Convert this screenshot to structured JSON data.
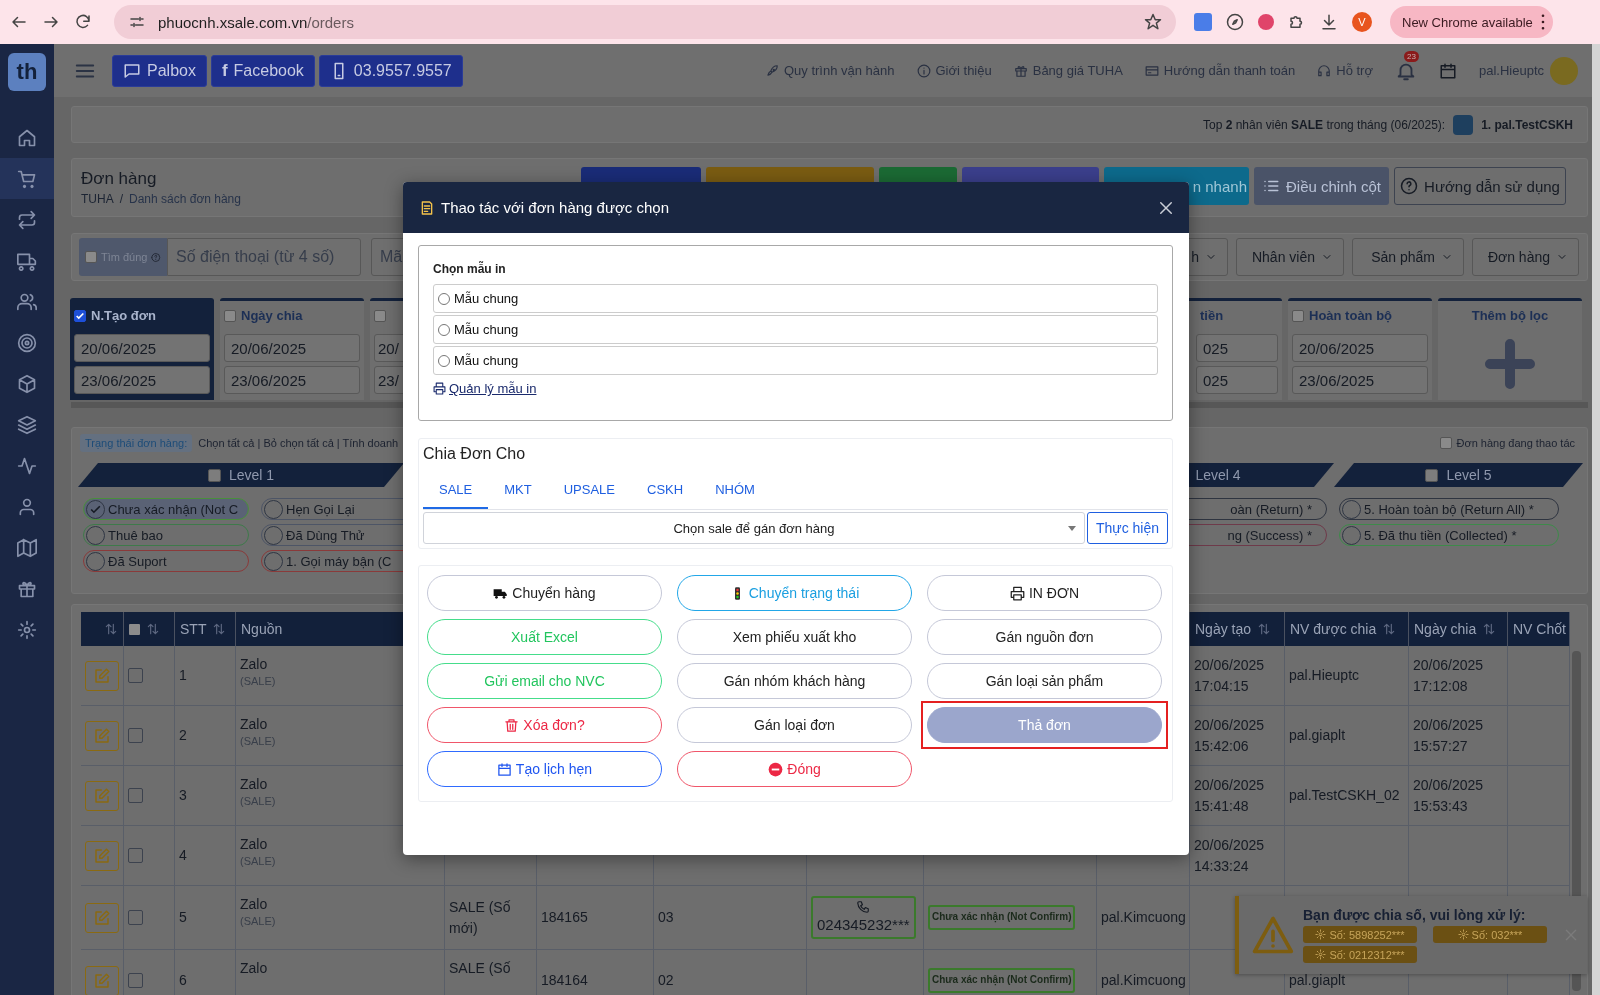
{
  "browser": {
    "host": "phuocnh.xsale.com.vn",
    "path": "/orders",
    "profile_initial": "V",
    "update_label": "New Chrome available"
  },
  "sidebar": {
    "logo": "th",
    "items": [
      {
        "selected": false
      },
      {
        "selected": true
      },
      {
        "selected": false
      },
      {
        "selected": false
      },
      {
        "selected": false
      },
      {
        "selected": false
      },
      {
        "selected": false
      },
      {
        "selected": false
      },
      {
        "selected": false
      },
      {
        "selected": false
      },
      {
        "selected": false
      },
      {
        "selected": false
      },
      {
        "selected": false
      }
    ]
  },
  "header": {
    "buttons": [
      {
        "label": "Palbox"
      },
      {
        "label": "Facebook",
        "icon_text": "f"
      },
      {
        "label": "03.9557.9557"
      }
    ],
    "links": [
      "Quy trình vận hành",
      "Giới thiệu",
      "Bảng giá TUHA",
      "Hướng dẫn thanh toán",
      "Hỗ trợ"
    ],
    "notification_count": "23",
    "user": "pal.Hieuptc"
  },
  "ranking": {
    "text": "Top **2** nhân viên **SALE** trong tháng (06/2025):",
    "leader": "1. pal.TestCSKH"
  },
  "page": {
    "title": "Đơn hàng",
    "breadcrumb": [
      "TUHA",
      "Danh sách đơn hàng"
    ],
    "breadcrumb_separator": "/"
  },
  "toolbar": [
    {
      "kind": "solid",
      "color": "#1a2c78"
    },
    {
      "kind": "solid",
      "color": "#7a5c12"
    },
    {
      "kind": "solid",
      "color": "#1b6a34"
    },
    {
      "kind": "solid",
      "color": "#3b3f8c"
    },
    {
      "kind": "solid",
      "color": "#0d6a8c",
      "label": "n nhanh"
    },
    {
      "kind": "list",
      "color": "#4a5368",
      "label": "Điều chỉnh cột"
    },
    {
      "kind": "help",
      "color": "#6e6e6e",
      "label": "Hướng dẫn sử dụng"
    }
  ],
  "search": {
    "exact_match": {
      "label": "Tìm đúng",
      "checked": false
    },
    "phone_placeholder": "Số điện thoại (từ 4 số)",
    "code_placeholder": "Mã",
    "dropdowns": [
      "h",
      "Nhân viên",
      "Sản phẩm",
      "Đơn hàng"
    ]
  },
  "date_filters": {
    "left": [
      {
        "label": "N.Tạo đơn",
        "checked": true,
        "from": "20/06/2025",
        "to": "23/06/2025"
      },
      {
        "label": "Ngày chia",
        "checked": false,
        "from": "20/06/2025",
        "to": "23/06/2025"
      },
      {
        "checked": false,
        "from": "20/",
        "to": "23/"
      }
    ],
    "right": [
      {
        "label": "tiền",
        "from": "025",
        "to": "025"
      },
      {
        "label": "Hoàn toàn bộ",
        "checked": false,
        "from": "20/06/2025",
        "to": "23/06/2025"
      }
    ],
    "add_label": "Thêm bộ lọc"
  },
  "status_filter": {
    "tag": "Trạng thái đơn hàng:",
    "actions": "Chọn tất cả | Bỏ chọn tất cả | Tính doanh",
    "in_progress": {
      "label": "Đơn hàng đang thao tác",
      "checked": false
    },
    "levels": [
      {
        "label": "Level 1",
        "checked": false,
        "statuses": [
          {
            "label": "Chưa xác nhận (Not C",
            "checked": true,
            "color": "#4a8f3c"
          },
          {
            "label": "Hẹn Gọi Lại",
            "checked": false,
            "color": "#4d5566"
          },
          {
            "label": "Thuê bao",
            "checked": false,
            "color": "#3e7a4a"
          },
          {
            "label": "Đã Dùng Thử",
            "checked": false,
            "color": "#4d5566"
          },
          {
            "label": "Đã Suport",
            "checked": false,
            "color": "#8a3a3a"
          },
          {
            "label": "1. Gọi máy bận (C",
            "checked": false,
            "color": "#8a3a3a"
          }
        ]
      },
      {
        "label": "Level 4",
        "statuses": [
          {
            "label": "oàn (Return) *",
            "checked": false,
            "color": "#2e3440"
          },
          {
            "label": "ng (Success) *",
            "checked": false,
            "color": "#6e3a4a"
          }
        ]
      },
      {
        "label": "Level 5",
        "checked": false,
        "statuses": [
          {
            "label": "5. Hoàn toàn bộ (Return All) *",
            "checked": false,
            "color": "#2e3440"
          },
          {
            "label": "5. Đã thu tiền (Collected) *",
            "checked": false,
            "color": "#3e8a4a"
          }
        ]
      }
    ]
  },
  "table": {
    "all_selected": false,
    "columns": [
      {
        "kind": "sort"
      },
      {
        "kind": "select"
      },
      {
        "kind": "text",
        "label": "STT",
        "sortable": true
      },
      {
        "kind": "text",
        "label": "Nguồn",
        "sortable": false
      },
      {
        "kind": "blank"
      },
      {
        "kind": "blank"
      },
      {
        "kind": "blank"
      },
      {
        "kind": "blank"
      },
      {
        "kind": "blank"
      },
      {
        "kind": "blank"
      },
      {
        "kind": "text",
        "label": "Ngày tạo",
        "sortable": true
      },
      {
        "kind": "text",
        "label": "NV được chia",
        "sortable": true
      },
      {
        "kind": "text",
        "label": "Ngày chia",
        "sortable": true
      },
      {
        "kind": "text",
        "label": "NV Chốt"
      }
    ],
    "rows": [
      {
        "stt": "1",
        "selected": false,
        "source": "Zalo",
        "source_tag": "(SALE)",
        "created_date": "20/06/2025",
        "created_time": "17:04:15",
        "assignee": "pal.Hieuptc",
        "assigned_date": "20/06/2025",
        "assigned_time": "17:12:08"
      },
      {
        "stt": "2",
        "selected": false,
        "source": "Zalo",
        "source_tag": "(SALE)",
        "created_date": "20/06/2025",
        "created_time": "15:42:06",
        "assignee": "pal.giaplt",
        "assigned_date": "20/06/2025",
        "assigned_time": "15:57:27"
      },
      {
        "stt": "3",
        "selected": false,
        "source": "Zalo",
        "source_tag": "(SALE)",
        "created_date": "20/06/2025",
        "created_time": "15:41:48",
        "assignee": "pal.TestCSKH_02",
        "assigned_date": "20/06/2025",
        "assigned_time": "15:53:43"
      },
      {
        "stt": "4",
        "selected": false,
        "source": "Zalo",
        "source_tag": "(SALE)",
        "created_date": "20/06/2025",
        "created_time": "14:33:24"
      },
      {
        "stt": "5",
        "selected": false,
        "source": "Zalo",
        "source_tag": "(SALE)",
        "order_type": "SALE (Số mới)",
        "code": "184165",
        "name": "03",
        "phone": "024345232***",
        "status": "Chưa xác nhận (Not Confirm)",
        "staff": "pal.Kimcuong"
      },
      {
        "stt": "6",
        "selected": false,
        "source": "Zalo",
        "order_type": "SALE (Số",
        "code": "184164",
        "name": "02",
        "status": "Chưa xác nhận (Not Confirm)",
        "staff": "pal.Kimcuong",
        "assignee": "pal.giaplt"
      }
    ]
  },
  "modal": {
    "title": "Thao tác với đơn hàng được chọn",
    "print": {
      "heading": "Chọn mẫu in",
      "templates": [
        {
          "label": "Mẫu chung",
          "selected": false
        },
        {
          "label": "Mẫu chung",
          "selected": false
        },
        {
          "label": "Mẫu chung",
          "selected": false
        }
      ],
      "manage_link": "Quản lý mẫu in"
    },
    "assign": {
      "heading": "Chia Đơn Cho",
      "tabs": [
        {
          "label": "SALE",
          "selected": true
        },
        {
          "label": "MKT",
          "selected": false
        },
        {
          "label": "UPSALE",
          "selected": false
        },
        {
          "label": "CSKH",
          "selected": false
        },
        {
          "label": "NHÓM",
          "selected": false
        }
      ],
      "select_placeholder": "Chọn sale để gán đơn hàng",
      "submit": "Thực hiện"
    },
    "actions": [
      {
        "label": "Chuyển hàng",
        "kind": "default",
        "highlighted": false
      },
      {
        "label": "Chuyển trạng thái",
        "kind": "cyan",
        "highlighted": false
      },
      {
        "label": "IN ĐƠN",
        "kind": "default",
        "highlighted": false
      },
      {
        "label": "Xuất Excel",
        "kind": "green",
        "highlighted": false
      },
      {
        "label": "Xem phiếu xuất kho",
        "kind": "default",
        "highlighted": false
      },
      {
        "label": "Gán nguồn đơn",
        "kind": "default",
        "highlighted": false
      },
      {
        "label": "Gửi email cho NVC",
        "kind": "green",
        "highlighted": false
      },
      {
        "label": "Gán nhóm khách hàng",
        "kind": "default",
        "highlighted": false
      },
      {
        "label": "Gán loại sản phẩm",
        "kind": "default",
        "highlighted": false
      },
      {
        "label": "Xóa đơn?",
        "kind": "red",
        "highlighted": false
      },
      {
        "label": "Gán loại đơn",
        "kind": "default",
        "highlighted": false
      },
      {
        "label": "Thả đơn",
        "kind": "filled",
        "highlighted": true
      },
      {
        "label": "Tạo lịch hẹn",
        "kind": "blue",
        "highlighted": false
      },
      {
        "label": "Đóng",
        "kind": "red",
        "highlighted": false
      }
    ]
  },
  "toast": {
    "title": "Bạn được chia số, vui lòng xử lý:",
    "numbers": [
      "Số: 5898252***",
      "Số: 032***",
      "Số: 0212312***"
    ]
  }
}
